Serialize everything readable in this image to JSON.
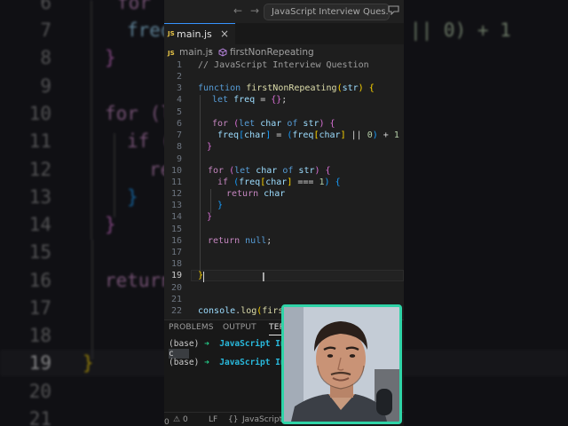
{
  "background": {
    "lines": [
      {
        "num": "6",
        "code": "for"
      },
      {
        "num": "7",
        "code": "freq"
      },
      {
        "num": "8",
        "code": "}"
      },
      {
        "num": "9",
        "code": ""
      },
      {
        "num": "10",
        "code": "for (l"
      },
      {
        "num": "11",
        "code": "if ("
      },
      {
        "num": "12",
        "code": "re"
      },
      {
        "num": "13",
        "code": "}"
      },
      {
        "num": "14",
        "code": "}"
      },
      {
        "num": "15",
        "code": ""
      },
      {
        "num": "16",
        "code": "return"
      },
      {
        "num": "17",
        "code": ""
      },
      {
        "num": "18",
        "code": ""
      },
      {
        "num": "19",
        "code": "}"
      },
      {
        "num": "20",
        "code": ""
      },
      {
        "num": "21",
        "code": ""
      }
    ],
    "right_fragment": "|| 0) + 1"
  },
  "titlebar": {
    "back": "←",
    "forward": "→",
    "search_text": "JavaScript Interview Ques..."
  },
  "tab": {
    "badge": "JS",
    "label": "main.js",
    "close": "×"
  },
  "breadcrumb": {
    "file": "main.js",
    "sep": "›",
    "symbol": "firstNonRepeating"
  },
  "code_lines": [
    {
      "num": "1"
    },
    {
      "num": "2"
    },
    {
      "num": "3"
    },
    {
      "num": "4"
    },
    {
      "num": "5"
    },
    {
      "num": "6"
    },
    {
      "num": "7"
    },
    {
      "num": "8"
    },
    {
      "num": "9"
    },
    {
      "num": "10"
    },
    {
      "num": "11"
    },
    {
      "num": "12"
    },
    {
      "num": "13"
    },
    {
      "num": "14"
    },
    {
      "num": "15"
    },
    {
      "num": "16"
    },
    {
      "num": "17"
    },
    {
      "num": "18"
    },
    {
      "num": "19"
    },
    {
      "num": "20"
    },
    {
      "num": "21"
    },
    {
      "num": "22"
    }
  ],
  "code_text": {
    "l1": "// JavaScript Interview Question",
    "l3_kw": "function",
    "l3_fn": "firstNonRepeating",
    "l3_arg": "str",
    "l4_kw": "let",
    "l4_var": "freq",
    "l6_kw": "for",
    "l6_kw2": "let",
    "l6_var": "char",
    "l6_of": "of",
    "l6_str": "str",
    "l7_a": "freq",
    "l7_b": "char",
    "l7_c": "freq",
    "l7_d": "char",
    "l7_zero": "0",
    "l7_one": "1",
    "l10_kw": "for",
    "l10_kw2": "let",
    "l10_var": "char",
    "l10_of": "of",
    "l10_str": "str",
    "l11_kw": "if",
    "l11_a": "freq",
    "l11_b": "char",
    "l11_one": "1",
    "l12_kw": "return",
    "l12_var": "char",
    "l16_kw": "return",
    "l16_null": "null",
    "l22_a": "console",
    "l22_b": "log",
    "l22_c": "firstN"
  },
  "panel": {
    "tabs": [
      "PROBLEMS",
      "OUTPUT",
      "TERMINAL"
    ],
    "terminal": [
      {
        "base": "(base)",
        "arrow": "➜",
        "dir": "JavaScript Interview Question"
      },
      {
        "text": "c"
      },
      {
        "base": "(base)",
        "arrow": "➜",
        "dir": "JavaScript Interview Question"
      }
    ]
  },
  "statusbar": {
    "errors": "0",
    "warnings": "0",
    "eol": "LF",
    "language": "JavaScript"
  },
  "colors": {
    "cam_border": "#2fd3a7",
    "tab_accent": "#3794ff",
    "terminal_arrow": "#23d18b",
    "terminal_dir": "#29b8db"
  }
}
